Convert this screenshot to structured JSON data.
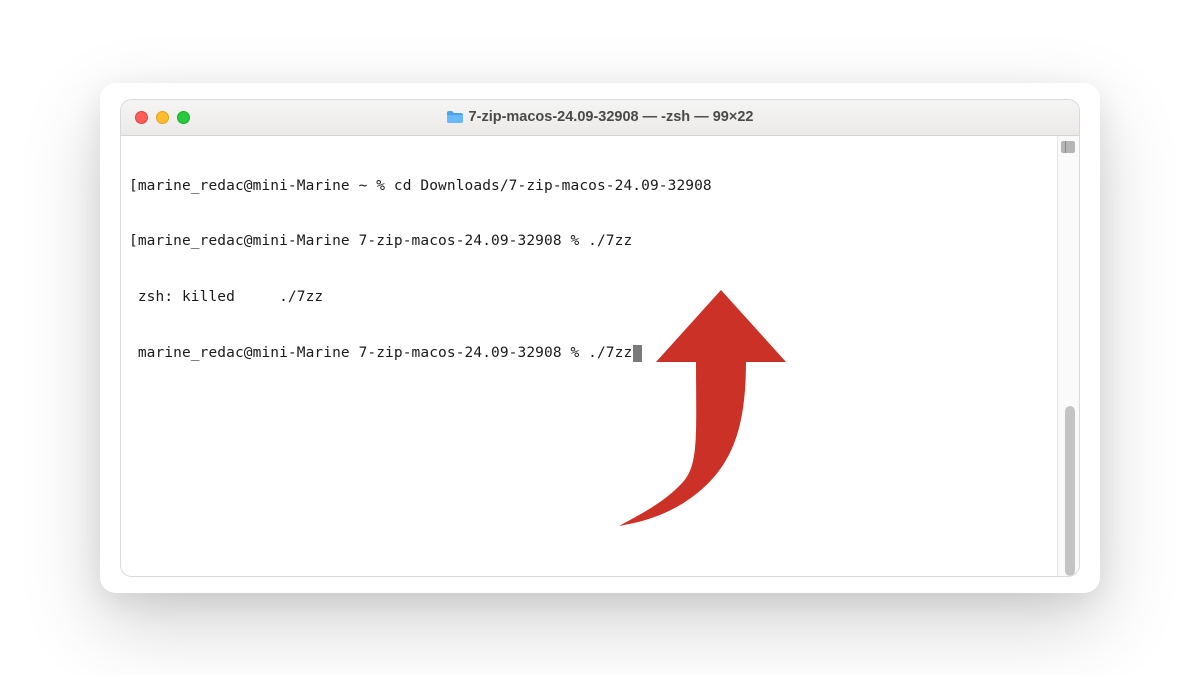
{
  "titlebar": {
    "title": "7-zip-macos-24.09-32908 — -zsh — 99×22",
    "icon_name": "folder-icon"
  },
  "traffic_lights": {
    "close_color": "#ff5f56",
    "minimize_color": "#ffbd2e",
    "maximize_color": "#27c93f"
  },
  "terminal": {
    "lines": [
      "[marine_redac@mini-Marine ~ % cd Downloads/7-zip-macos-24.09-32908",
      "[marine_redac@mini-Marine 7-zip-macos-24.09-32908 % ./7zz",
      " zsh: killed     ./7zz",
      " marine_redac@mini-Marine 7-zip-macos-24.09-32908 % ./7zz"
    ],
    "cursor_visible": true
  },
  "annotation": {
    "name": "curved-arrow-up",
    "color": "#cc3128"
  }
}
